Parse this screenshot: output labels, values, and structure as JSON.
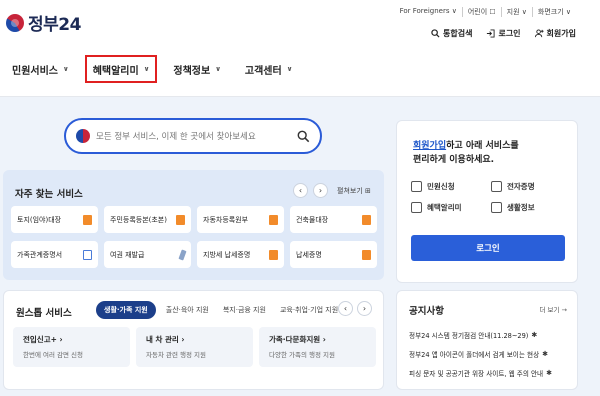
{
  "header": {
    "logo_text": "정부24",
    "util_links": [
      "For Foreigners ∨",
      "어린이 ☐",
      "지원 ∨",
      "화면크기 ∨"
    ],
    "quick_links": [
      {
        "label": "통합검색",
        "icon": "search-icon"
      },
      {
        "label": "로그인",
        "icon": "login-icon"
      },
      {
        "label": "회원가입",
        "icon": "user-plus-icon"
      }
    ]
  },
  "gnb": {
    "menus": [
      {
        "label": "민원서비스",
        "active": false
      },
      {
        "label": "혜택알리미",
        "active": true
      },
      {
        "label": "정책정보",
        "active": false
      },
      {
        "label": "고객센터",
        "active": false
      }
    ],
    "active_outline_color": "#e02020"
  },
  "search": {
    "placeholder": "모든 정부 서비스, 이제 한 곳에서 찾아보세요"
  },
  "login_panel": {
    "msg_highlight": "회원가입",
    "msg_rest_line1": "하고 아래 서비스를",
    "msg_line2": "편리하게 이용하세요.",
    "services": [
      {
        "label": "민원신청",
        "icon": "document-icon"
      },
      {
        "label": "전자증명",
        "icon": "certificate-icon"
      },
      {
        "label": "혜택알리미",
        "icon": "gift-icon"
      },
      {
        "label": "생활정보",
        "icon": "card-icon"
      }
    ],
    "button": "로그인",
    "button_color": "#2a5fd9"
  },
  "frequent": {
    "title": "자주 찾는 서비스",
    "prev": "‹",
    "next": "›",
    "view_all": "펼쳐보기 ⊞",
    "cards": [
      {
        "label": "토지(임야)대장",
        "icon": "file-icon"
      },
      {
        "label": "주민등록등본(초본)",
        "icon": "file-icon"
      },
      {
        "label": "자동차등록원부",
        "icon": "file-icon"
      },
      {
        "label": "건축물대장",
        "icon": "file-icon"
      },
      {
        "label": "가족관계증명서",
        "icon": "external-link-icon"
      },
      {
        "label": "여권 재발급",
        "icon": "pen-icon"
      },
      {
        "label": "지방세 납세증명",
        "icon": "file-icon"
      },
      {
        "label": "납세증명",
        "icon": "file-icon"
      }
    ]
  },
  "onestop": {
    "title": "원스톱 서비스",
    "tabs": [
      {
        "label": "생활·가족 지원",
        "active": true
      },
      {
        "label": "출산·육아 지원",
        "active": false
      },
      {
        "label": "복지·금융 지원",
        "active": false
      },
      {
        "label": "교육·취업·기업 지원",
        "active": false
      }
    ],
    "prev": "‹",
    "next": "›",
    "cards": [
      {
        "title": "전입신고+ ›",
        "desc": "한번에 여러 감면 신청"
      },
      {
        "title": "내 차 관리 ›",
        "desc": "자동차 관련 행정 지원"
      },
      {
        "title": "가족·다문화지원 ›",
        "desc": "다양한 가족의 행정 지원"
      }
    ]
  },
  "notice": {
    "title": "공지사항",
    "more": "더 보기 →",
    "items": [
      "정부24 시스템 정기점검 안내(11.28~29)",
      "정부24 앱 아이콘이 폴더에서 검게 보이는 현상",
      "피싱 문자 및 공공기관 위장 사이트, 웹 주의 안내"
    ]
  }
}
